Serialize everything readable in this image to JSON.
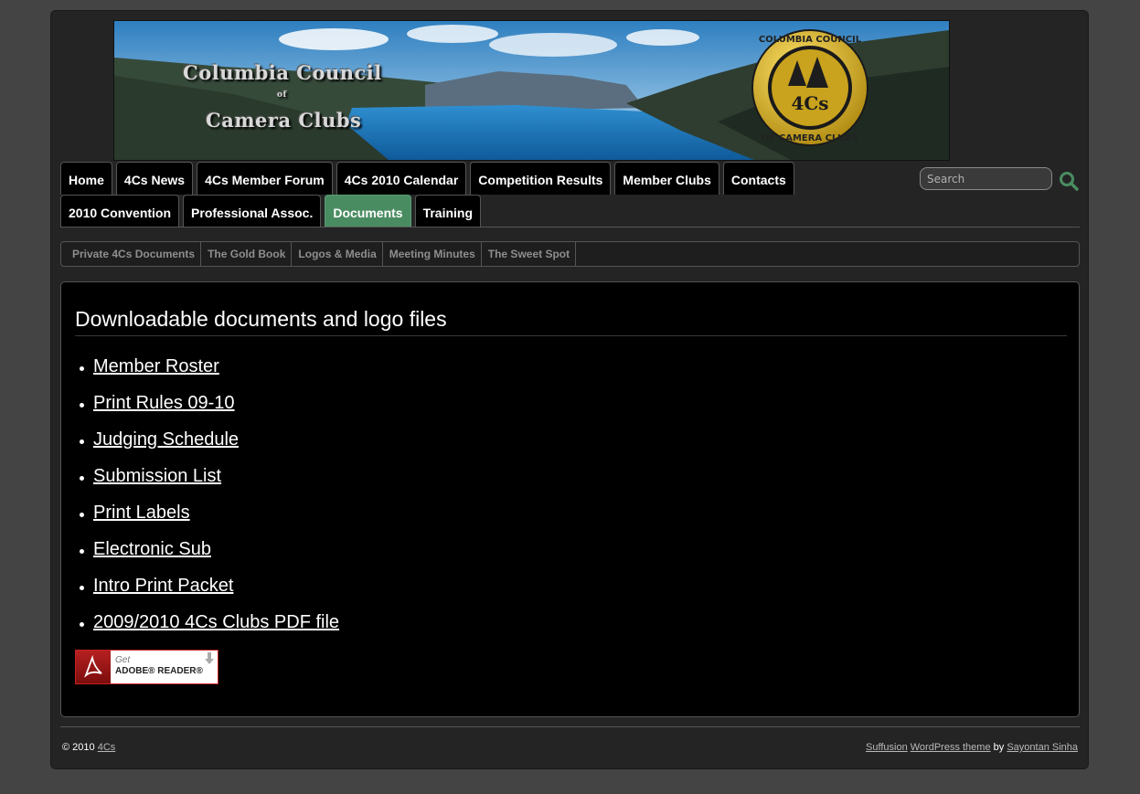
{
  "banner": {
    "line1": "Columbia Council",
    "line2": "of",
    "line3": "Camera Clubs",
    "seal_top": "COLUMBIA COUNCIL",
    "seal_bottom": "OF CAMERA CLUBS",
    "seal_center": "4Cs"
  },
  "nav": {
    "row1": [
      "Home",
      "4Cs News",
      "4Cs Member Forum",
      "4Cs 2010 Calendar",
      "Competition Results",
      "Member Clubs",
      "Contacts"
    ],
    "row2": [
      "2010 Convention",
      "Professional Assoc.",
      "Documents",
      "Training"
    ],
    "active": "Documents",
    "active_color": "#4a8c61"
  },
  "search": {
    "placeholder": "Search",
    "icon": "magnifier-icon",
    "icon_color": "#4a8c61"
  },
  "subnav": [
    "Private 4Cs Documents",
    "The Gold Book",
    "Logos & Media",
    "Meeting Minutes",
    "The Sweet Spot"
  ],
  "main": {
    "title": "Downloadable documents and logo files",
    "documents": [
      "Member Roster",
      "Print Rules 09-10",
      "Judging Schedule",
      "Submission List",
      "Print Labels",
      "Electronic Sub",
      "Intro Print Packet",
      "2009/2010 4Cs Clubs PDF file"
    ],
    "adobe": {
      "get": "Get",
      "name": "ADOBE® READER®"
    }
  },
  "footer": {
    "copyright": "© 2010",
    "site_link": "4Cs",
    "theme_link": "Suffusion",
    "platform_link": "WordPress theme",
    "by": "by",
    "author_link": "Sayontan Sinha"
  }
}
